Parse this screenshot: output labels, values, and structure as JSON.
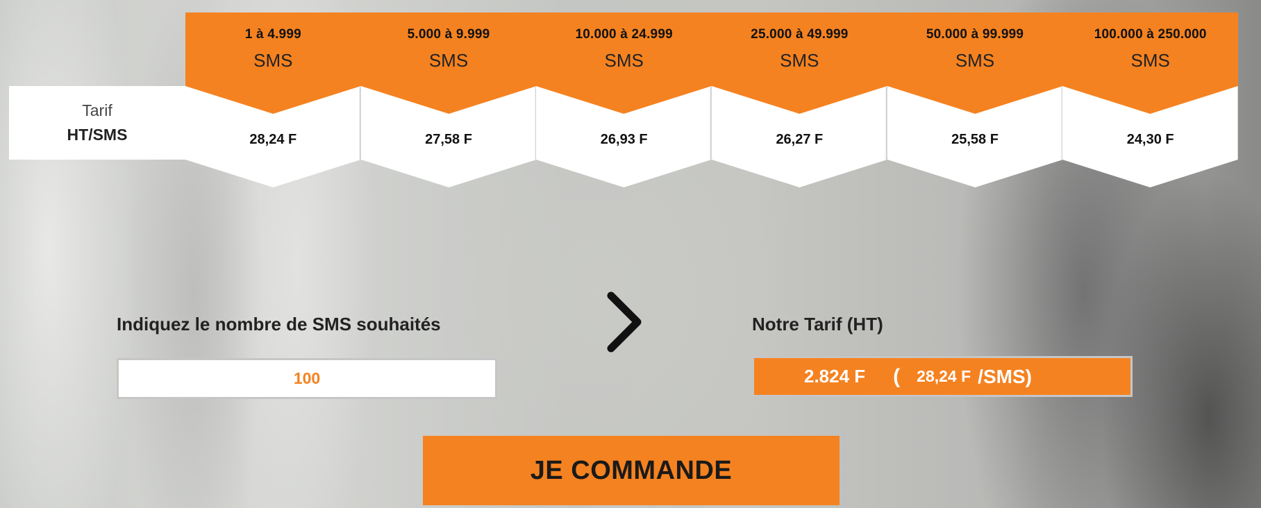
{
  "pricing": {
    "row_label_line1": "Tarif",
    "row_label_line2": "HT/SMS",
    "tiers": [
      {
        "range": "1 à 4.999",
        "unit": "SMS",
        "price": "28,24 F"
      },
      {
        "range": "5.000 à 9.999",
        "unit": "SMS",
        "price": "27,58 F"
      },
      {
        "range": "10.000 à 24.999",
        "unit": "SMS",
        "price": "26,93 F"
      },
      {
        "range": "25.000 à 49.999",
        "unit": "SMS",
        "price": "26,27 F"
      },
      {
        "range": "50.000 à 99.999",
        "unit": "SMS",
        "price": "25,58 F"
      },
      {
        "range": "100.000 à 250.000",
        "unit": "SMS",
        "price": "24,30 F"
      }
    ]
  },
  "form": {
    "quantity_label": "Indiquez le nombre de SMS souhaités",
    "quantity_value": "100",
    "result_label": "Notre Tarif (HT)",
    "result_total": "2.824 F",
    "result_open": "(",
    "result_unit_price": "28,24 F",
    "result_per": "/SMS)",
    "order_button": "JE COMMANDE"
  },
  "icons": {
    "arrow": "chevron-right-icon"
  },
  "colors": {
    "accent": "#f58220"
  }
}
